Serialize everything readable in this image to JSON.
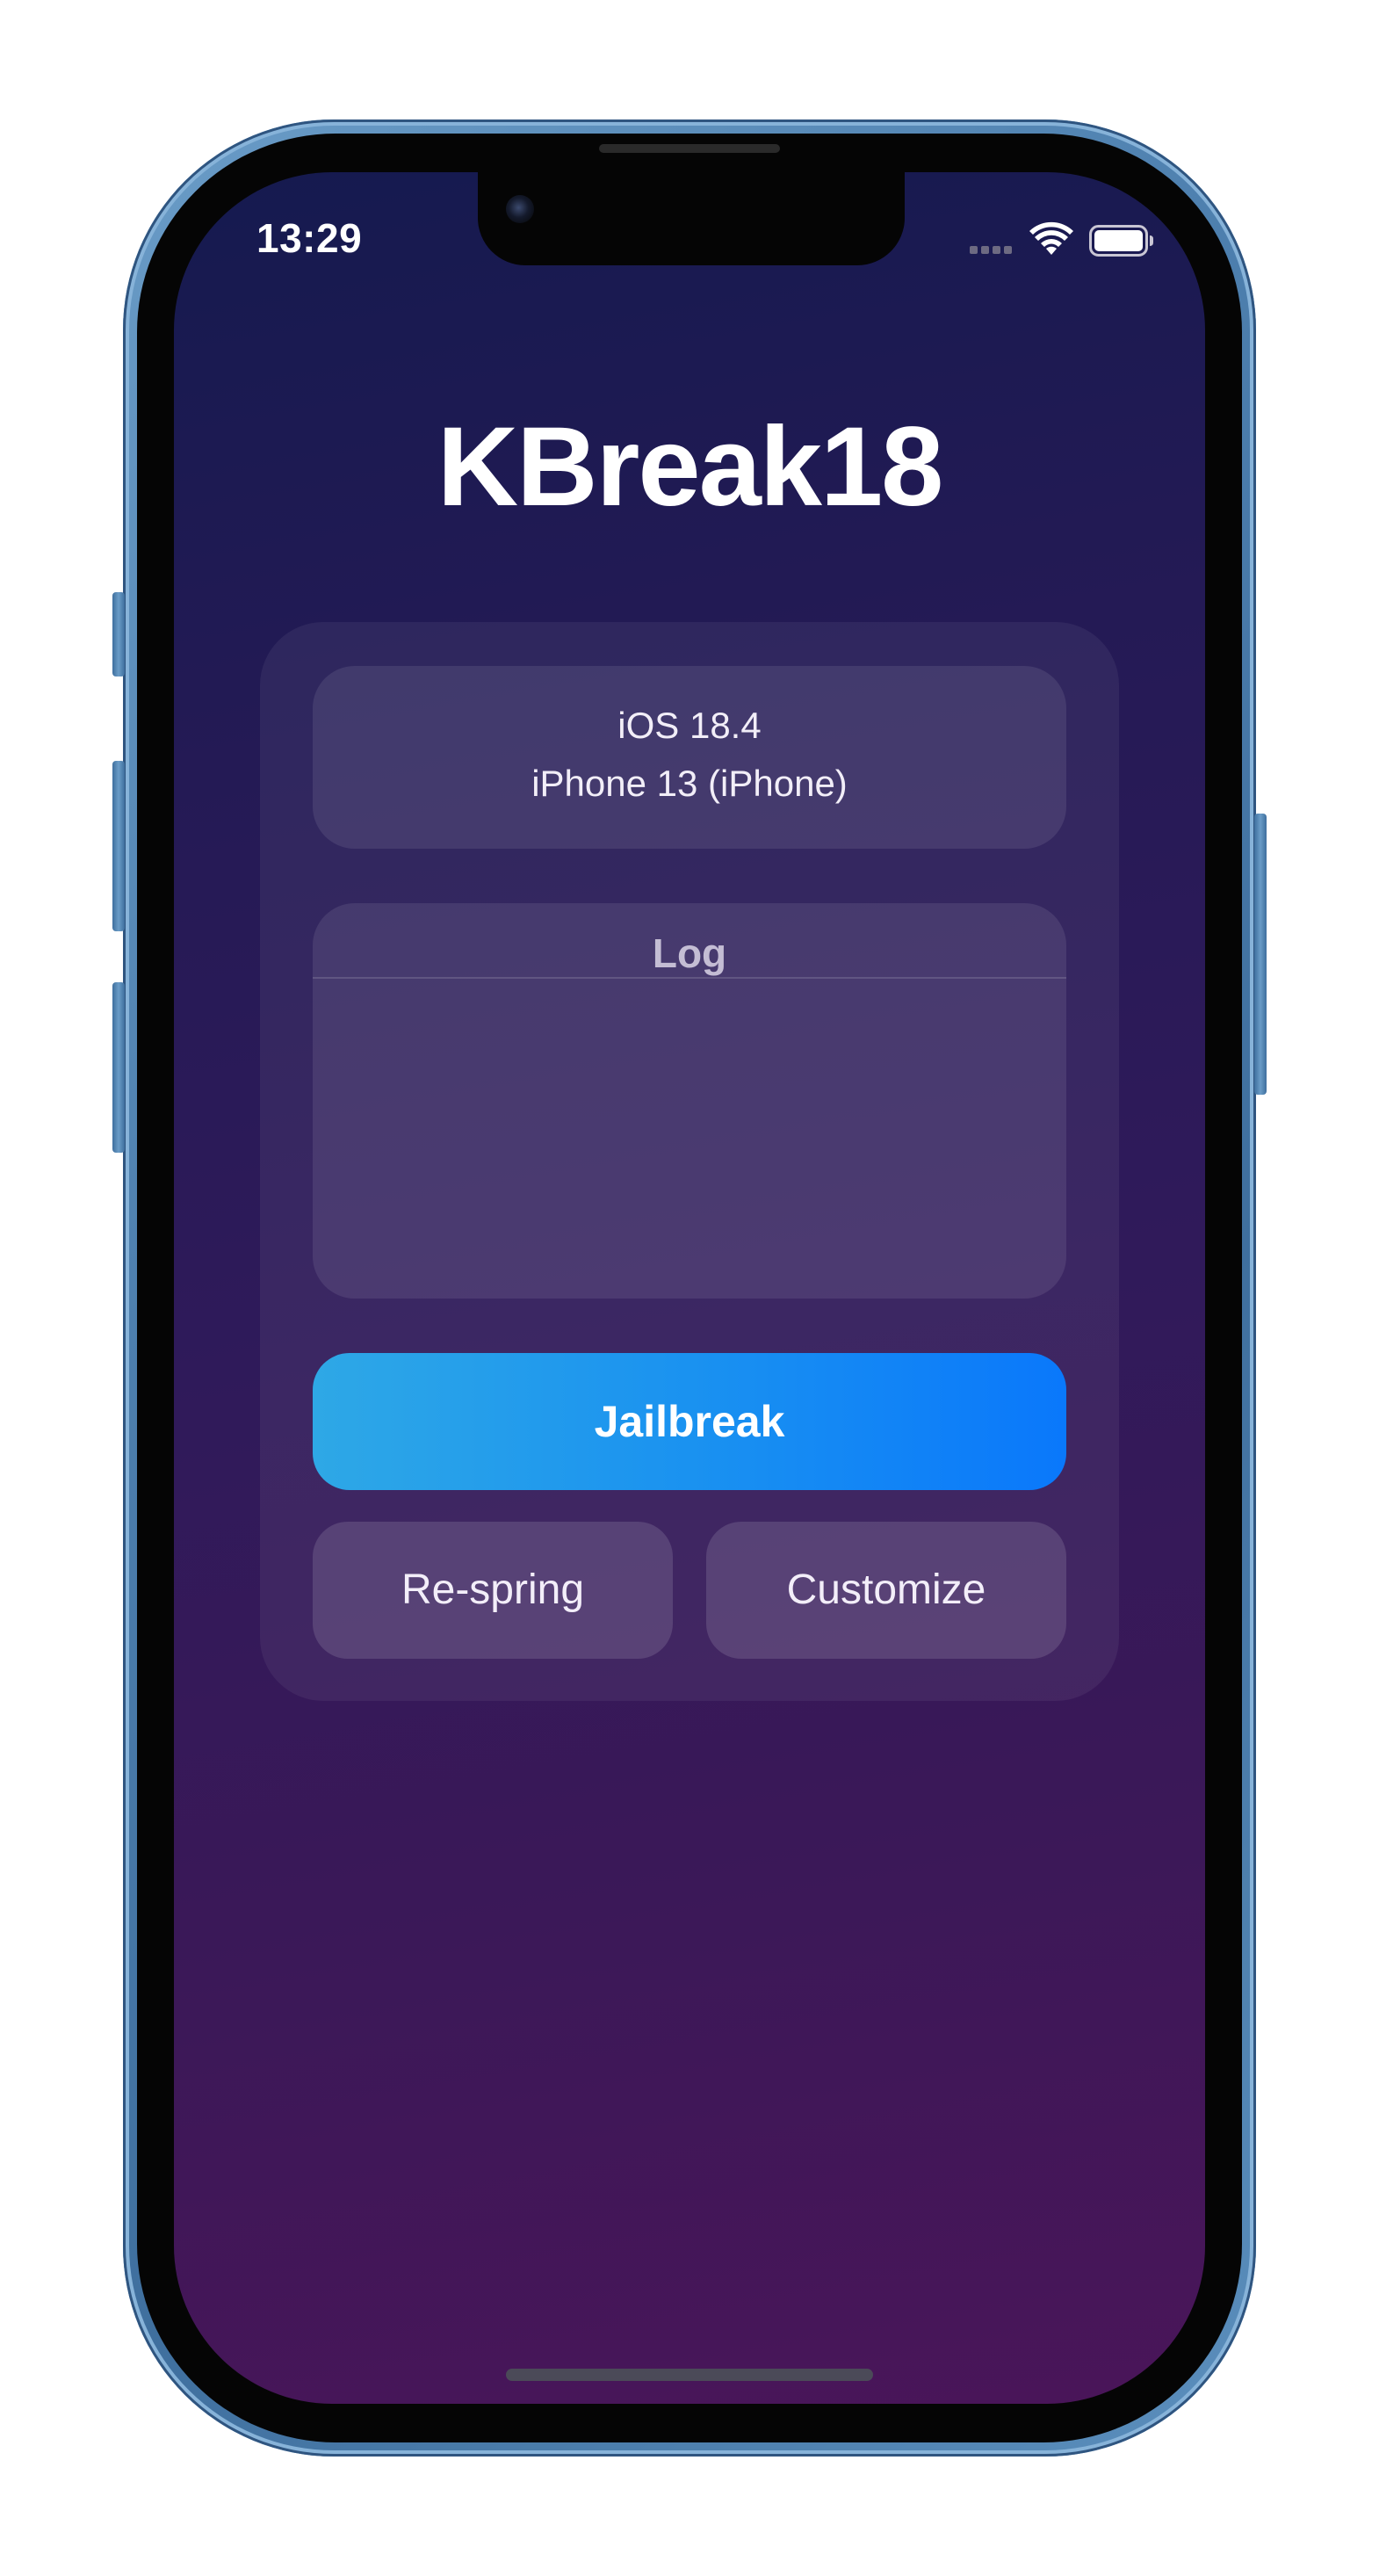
{
  "status_bar": {
    "time": "13:29",
    "wifi_icon": "wifi-icon",
    "battery_icon": "battery-icon",
    "signal_icon": "cellular-signal-icon"
  },
  "app": {
    "title": "KBreak18"
  },
  "device_info": {
    "os_version": "iOS 18.4",
    "device_model": "iPhone 13 (iPhone)"
  },
  "log": {
    "title": "Log",
    "content": ""
  },
  "actions": {
    "jailbreak_label": "Jailbreak",
    "respring_label": "Re-spring",
    "customize_label": "Customize"
  },
  "colors": {
    "background_top": "#151a4f",
    "background_bottom": "#4a1559",
    "jailbreak_gradient_start": "#2ea8e6",
    "jailbreak_gradient_end": "#0a78fb",
    "device_frame": "#4d7fae"
  }
}
